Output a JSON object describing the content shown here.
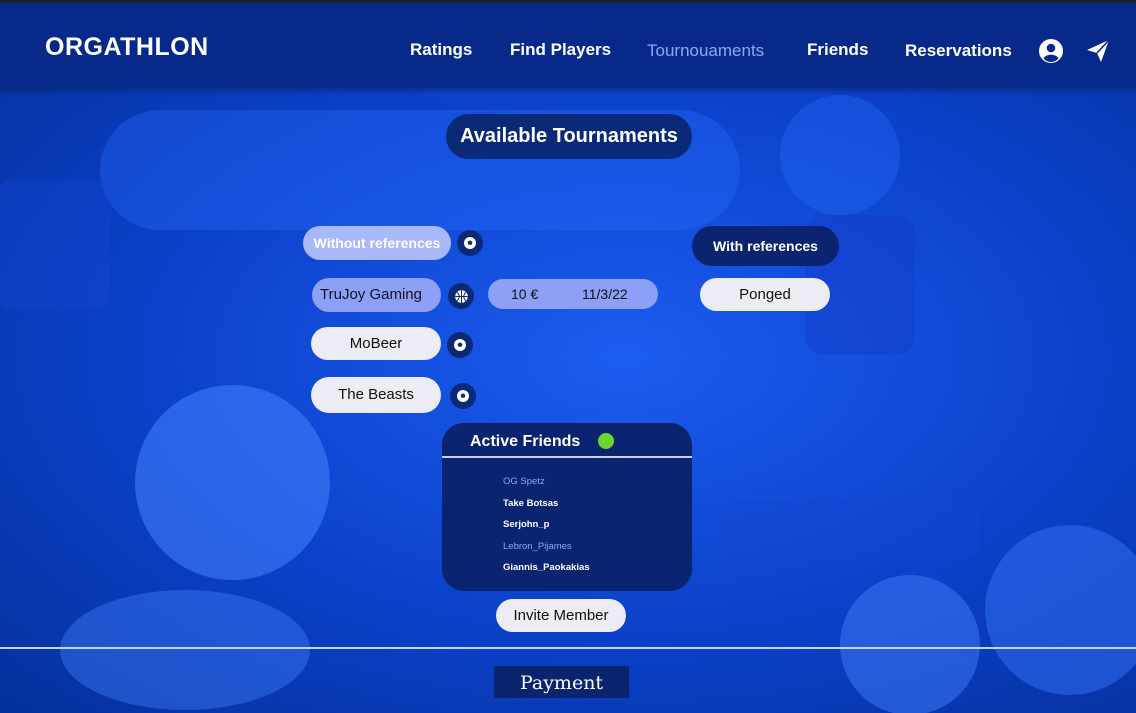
{
  "header": {
    "brand": "ORGATHLON",
    "nav": [
      "Ratings",
      "Find Players",
      "Tournouaments",
      "Friends",
      "Reservations"
    ],
    "active_nav": "Tournouaments",
    "icons": [
      "account-circle-icon",
      "send-icon"
    ]
  },
  "main": {
    "title": "Available Tournaments",
    "filters": {
      "without_references": "Without references",
      "with_references": "With references"
    },
    "tournaments_left": [
      {
        "name": "TruJoy Gaming",
        "icon": "basketball-icon"
      },
      {
        "name": "MoBeer",
        "icon": "soccer-ball-icon"
      },
      {
        "name": "The Beasts",
        "icon": "soccer-ball-icon"
      }
    ],
    "selected_info": {
      "price": "10 €",
      "date": "11/3/22"
    },
    "tournaments_right": [
      {
        "name": "Ponged"
      }
    ],
    "filter_icon": "soccer-ball-icon"
  },
  "friends_panel": {
    "title": "Active Friends",
    "status_color": "#6dd62c",
    "friends": [
      {
        "name": "OG Spetz",
        "dim": true
      },
      {
        "name": "Take Botsas",
        "dim": false
      },
      {
        "name": "Serjohn_p",
        "dim": false
      },
      {
        "name": "Lebron_Pijames",
        "dim": true
      },
      {
        "name": "Giannis_Paokakias",
        "dim": false
      }
    ],
    "invite_label": "Invite Member"
  },
  "footer": {
    "payment_label": "Payment"
  },
  "colors": {
    "nav_bg": "#072a8a",
    "accent": "#8ea0f5",
    "panel": "#0b2470"
  }
}
